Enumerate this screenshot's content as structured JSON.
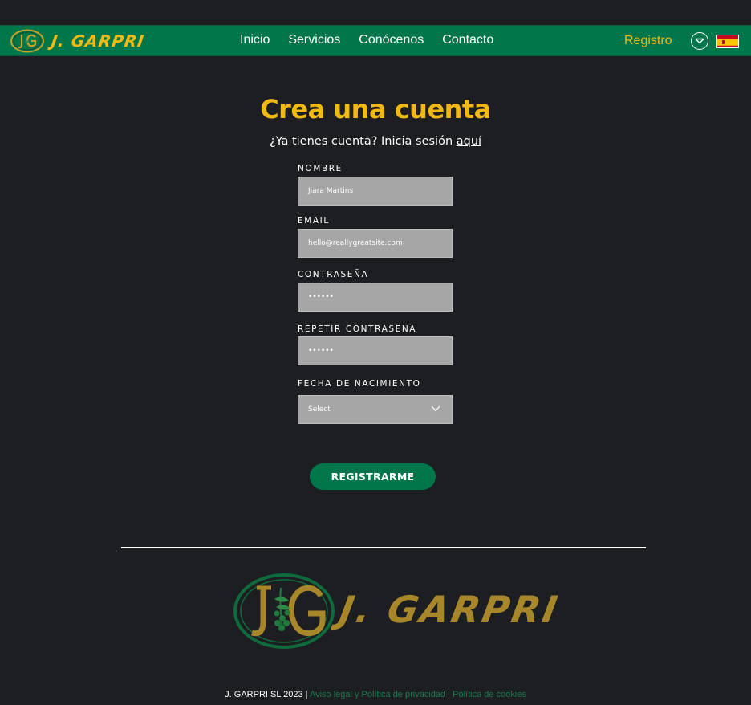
{
  "brand": {
    "name": "J. GARPRI",
    "primary_color": "#00764a",
    "accent_color": "#f1b911",
    "background_color": "#1d1e22"
  },
  "nav": {
    "links": [
      "Inicio",
      "Servicios",
      "Conócenos",
      "Contacto"
    ],
    "register": "Registro",
    "dropdown_icon": "chevron-circle-icon",
    "flag_icon": "spain-flag-icon"
  },
  "page": {
    "title": "Crea una cuenta",
    "subtitle_text": "¿Ya tienes cuenta? Inicia sesión ",
    "subtitle_link": "aquí"
  },
  "form": {
    "name_label": "NOMBRE",
    "name_value": "Jiara Martins",
    "email_label": "EMAIL",
    "email_value": "hello@reallygreatsite.com",
    "password_label": "CONTRASEÑA",
    "password_value": "••••••",
    "repeat_password_label": "REPETIR CONTRASEÑA",
    "repeat_password_value": "••••••",
    "birthdate_label": "FECHA DE NACIMIENTO",
    "birthdate_value": "Select",
    "submit_label": "REGISTRARME"
  },
  "footer": {
    "copyright": "J. GARPRI SL 2023",
    "separator": " | ",
    "legal_link": "Aviso legal y Política de privacidad",
    "cookies_link": "Política de cookies"
  }
}
